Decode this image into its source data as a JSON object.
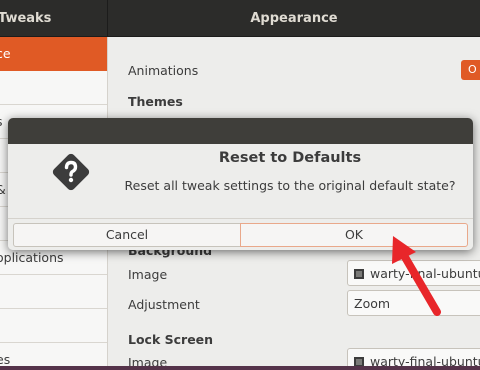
{
  "app": {
    "left_title": "Tweaks",
    "main_title": "Appearance"
  },
  "sidebar": {
    "items": [
      {
        "label": "Appearance",
        "visible_text": "ce",
        "active": true
      },
      {
        "label": "",
        "visible_text": "",
        "active": false
      },
      {
        "label": "",
        "visible_text": "s",
        "active": false
      },
      {
        "label": "",
        "visible_text": "",
        "active": false
      },
      {
        "label": "",
        "visible_text": "&",
        "active": false
      },
      {
        "label": "",
        "visible_text": "",
        "active": false
      },
      {
        "label": "Startup Applications",
        "visible_text": "oplications",
        "active": false
      },
      {
        "label": "",
        "visible_text": "",
        "active": false
      },
      {
        "label": "",
        "visible_text": "",
        "active": false
      },
      {
        "label": "",
        "visible_text": "es",
        "active": false
      }
    ]
  },
  "content": {
    "animations_label": "Animations",
    "animations_toggle_text": "O",
    "themes_heading": "Themes",
    "background_heading": "Background",
    "background_image_label": "Image",
    "background_image_value": "warty-final-ubuntu",
    "background_adjustment_label": "Adjustment",
    "background_adjustment_value": "Zoom",
    "lock_screen_heading": "Lock Screen",
    "lock_image_label": "Image",
    "lock_image_value": "warty-final-ubuntu"
  },
  "dialog": {
    "title": "Reset to Defaults",
    "message": "Reset all tweak settings to the original default state?",
    "cancel_label": "Cancel",
    "ok_label": "OK",
    "icon": "question-mark-warning-icon"
  },
  "colors": {
    "accent": "#e05a25",
    "headerbar": "#2c2c2a",
    "pointer_arrow": "#e8262a"
  }
}
